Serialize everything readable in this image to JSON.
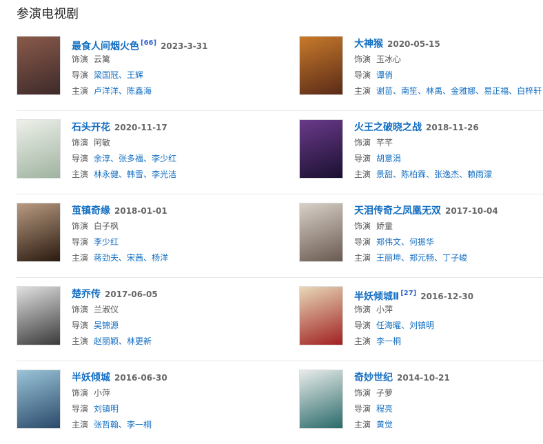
{
  "section_title": "参演电视剧",
  "labels": {
    "role": "饰演",
    "director": "导演",
    "starring": "主演",
    "sep": "、"
  },
  "entries": [
    {
      "title": "最食人间烟火色",
      "ref": "[66]",
      "date": "2023-3-31",
      "role": "云篱",
      "directors": [
        "梁国冠",
        "王辉"
      ],
      "stars": [
        "卢洋洋",
        "陈鑫海"
      ],
      "poster_colors": [
        "#8a5a4a",
        "#3d2a2a"
      ]
    },
    {
      "title": "大神猴",
      "ref": "",
      "date": "2020-05-15",
      "role": "玉冰心",
      "directors": [
        "谭俏"
      ],
      "stars": [
        "谢苗",
        "南笙",
        "林禹",
        "金雅娜",
        "易正福",
        "白梓轩"
      ],
      "poster_colors": [
        "#c77a2a",
        "#5a2a18"
      ]
    },
    {
      "title": "石头开花",
      "ref": "",
      "date": "2020-11-17",
      "role": "阿敏",
      "directors": [
        "余淳",
        "张多福",
        "李少红"
      ],
      "stars": [
        "林永健",
        "韩雪",
        "李光洁"
      ],
      "poster_colors": [
        "#eef0ea",
        "#9fb3a0"
      ]
    },
    {
      "title": "火王之破晓之战",
      "ref": "",
      "date": "2018-11-26",
      "role": "芊芊",
      "directors": [
        "胡意涓"
      ],
      "stars": [
        "景甜",
        "陈柏霖",
        "张逸杰",
        "赖雨濛"
      ],
      "poster_colors": [
        "#6a3a8a",
        "#1a1030"
      ]
    },
    {
      "title": "茧镇奇缘",
      "ref": "",
      "date": "2018-01-01",
      "role": "白子枫",
      "directors": [
        "李少红"
      ],
      "stars": [
        "蒋劲夫",
        "宋茜",
        "杨洋"
      ],
      "poster_colors": [
        "#b89a80",
        "#2a1a10"
      ]
    },
    {
      "title": "天泪传奇之凤凰无双",
      "ref": "",
      "date": "2017-10-04",
      "role": "娇童",
      "directors": [
        "郑伟文",
        "何振华"
      ],
      "stars": [
        "王丽坤",
        "郑元畅",
        "丁子峻"
      ],
      "poster_colors": [
        "#d8d0c8",
        "#6a5a50"
      ]
    },
    {
      "title": "楚乔传",
      "ref": "",
      "date": "2017-06-05",
      "role": "兰淑仪",
      "directors": [
        "吴锦源"
      ],
      "stars": [
        "赵丽颖",
        "林更新"
      ],
      "poster_colors": [
        "#e0e0e0",
        "#3a3a3a"
      ]
    },
    {
      "title": "半妖倾城Ⅱ",
      "ref": "[27]",
      "date": "2016-12-30",
      "role": "小萍",
      "directors": [
        "任海曜",
        "刘镇明"
      ],
      "stars": [
        "李一桐"
      ],
      "poster_colors": [
        "#e8d8b8",
        "#a02020"
      ]
    },
    {
      "title": "半妖倾城",
      "ref": "",
      "date": "2016-06-30",
      "role": "小萍",
      "directors": [
        "刘镇明"
      ],
      "stars": [
        "张哲翰",
        "李一桐"
      ],
      "poster_colors": [
        "#9ac4d8",
        "#2a4a6a"
      ]
    },
    {
      "title": "奇妙世纪",
      "ref": "",
      "date": "2014-10-21",
      "role": "子萝",
      "directors": [
        "程亮"
      ],
      "stars": [
        "黄觉"
      ],
      "poster_colors": [
        "#e8ecea",
        "#2a6a6a"
      ]
    }
  ]
}
